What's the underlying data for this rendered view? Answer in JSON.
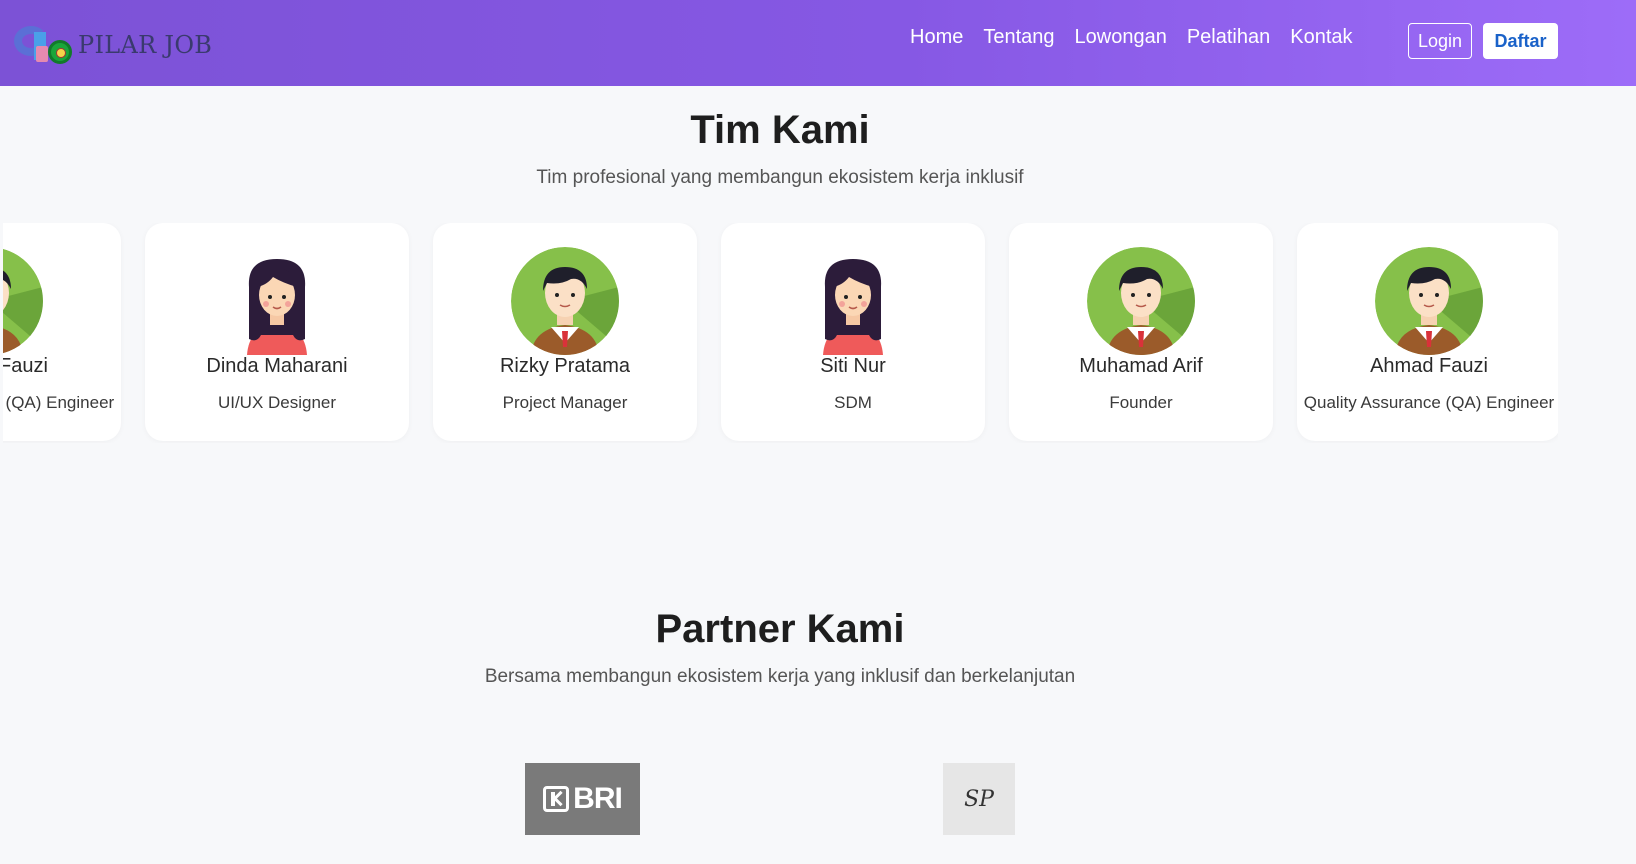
{
  "brand": {
    "name": "PILAR JOB",
    "logo_icon": "pilar-job-logo"
  },
  "nav": {
    "links": [
      "Home",
      "Tentang",
      "Lowongan",
      "Pelatihan",
      "Kontak"
    ],
    "login_label": "Login",
    "register_label": "Daftar"
  },
  "team": {
    "title": "Tim Kami",
    "subtitle": "Tim profesional yang membangun ekosistem kerja inklusif",
    "members": [
      {
        "name": "Ahmad Fauzi",
        "role": "Quality Assurance (QA) Engineer",
        "avatar": "male-avatar-icon"
      },
      {
        "name": "Dinda Maharani",
        "role": "UI/UX Designer",
        "avatar": "female-avatar-icon"
      },
      {
        "name": "Rizky Pratama",
        "role": "Project Manager",
        "avatar": "male-avatar-icon"
      },
      {
        "name": "Siti Nur",
        "role": "SDM",
        "avatar": "female-avatar-icon"
      },
      {
        "name": "Muhamad Arif",
        "role": "Founder",
        "avatar": "male-avatar-icon"
      },
      {
        "name": "Ahmad Fauzi",
        "role": "Quality Assurance (QA) Engineer",
        "avatar": "male-avatar-icon"
      }
    ]
  },
  "partners": {
    "title": "Partner Kami",
    "subtitle": "Bersama membangun ekosistem kerja yang inklusif dan berkelanjutan",
    "logos": [
      {
        "text": "BRI",
        "icon": "bri-logo"
      },
      {
        "text": "SP",
        "icon": "sp-monogram-logo"
      }
    ]
  },
  "colors": {
    "nav_gradient_start": "#7c52d6",
    "nav_gradient_end": "#9d6cf8",
    "register_text": "#1a62c9",
    "page_bg": "#f7f8fa",
    "card_bg": "#ffffff"
  }
}
